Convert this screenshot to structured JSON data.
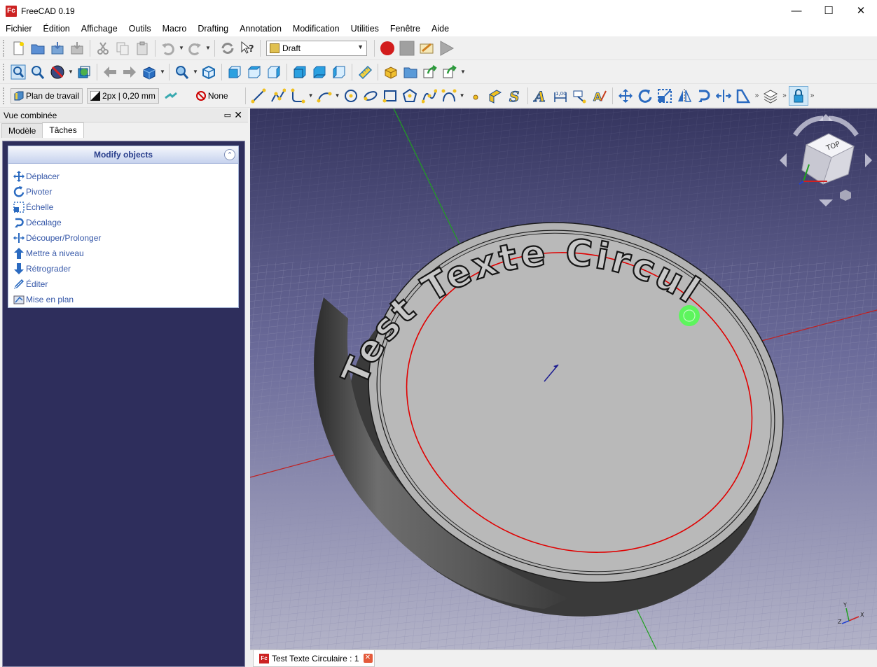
{
  "window": {
    "title": "FreeCAD 0.19",
    "app_icon": "Fc",
    "controls": {
      "minimize": "—",
      "maximize": "☐",
      "close": "✕"
    }
  },
  "menubar": {
    "items": [
      "Fichier",
      "Édition",
      "Affichage",
      "Outils",
      "Macro",
      "Drafting",
      "Annotation",
      "Modification",
      "Utilities",
      "Fenêtre",
      "Aide"
    ]
  },
  "toolbar": {
    "workbench": "Draft",
    "working_plane": "Plan de travail",
    "line_style": "2px | 0,20 mm",
    "snap_none": "None",
    "overflow": "»"
  },
  "combo_view": {
    "title": "Vue combinée",
    "float_icon": "▭",
    "close_icon": "✕",
    "tabs": [
      {
        "label": "Modèle",
        "active": false
      },
      {
        "label": "Tâches",
        "active": true
      }
    ]
  },
  "task_panel": {
    "title": "Modify objects",
    "collapse_icon": "⌃",
    "items": [
      {
        "label": "Déplacer",
        "icon": "move-icon"
      },
      {
        "label": "Pivoter",
        "icon": "rotate-icon"
      },
      {
        "label": "Échelle",
        "icon": "scale-icon"
      },
      {
        "label": "Décalage",
        "icon": "offset-icon"
      },
      {
        "label": "Découper/Prolonger",
        "icon": "trimex-icon"
      },
      {
        "label": "Mettre à niveau",
        "icon": "upgrade-icon"
      },
      {
        "label": "Rétrograder",
        "icon": "downgrade-icon"
      },
      {
        "label": "Éditer",
        "icon": "edit-icon"
      },
      {
        "label": "Mise en plan",
        "icon": "drawing-icon"
      }
    ]
  },
  "viewport": {
    "model_text": "Test Texte Circulaire",
    "navcube_face": "TOP",
    "axis_labels": {
      "x": "X",
      "y": "Y",
      "z": "Z"
    },
    "colors": {
      "background_top": "#35355f",
      "background_bottom": "#b3b3c8",
      "disc_face": "#b9b9b9",
      "circle": "#e00000",
      "grid": "#8d8db0"
    }
  },
  "document_tab": {
    "label": "Test Texte Circulaire : 1",
    "close_icon": "✕"
  }
}
